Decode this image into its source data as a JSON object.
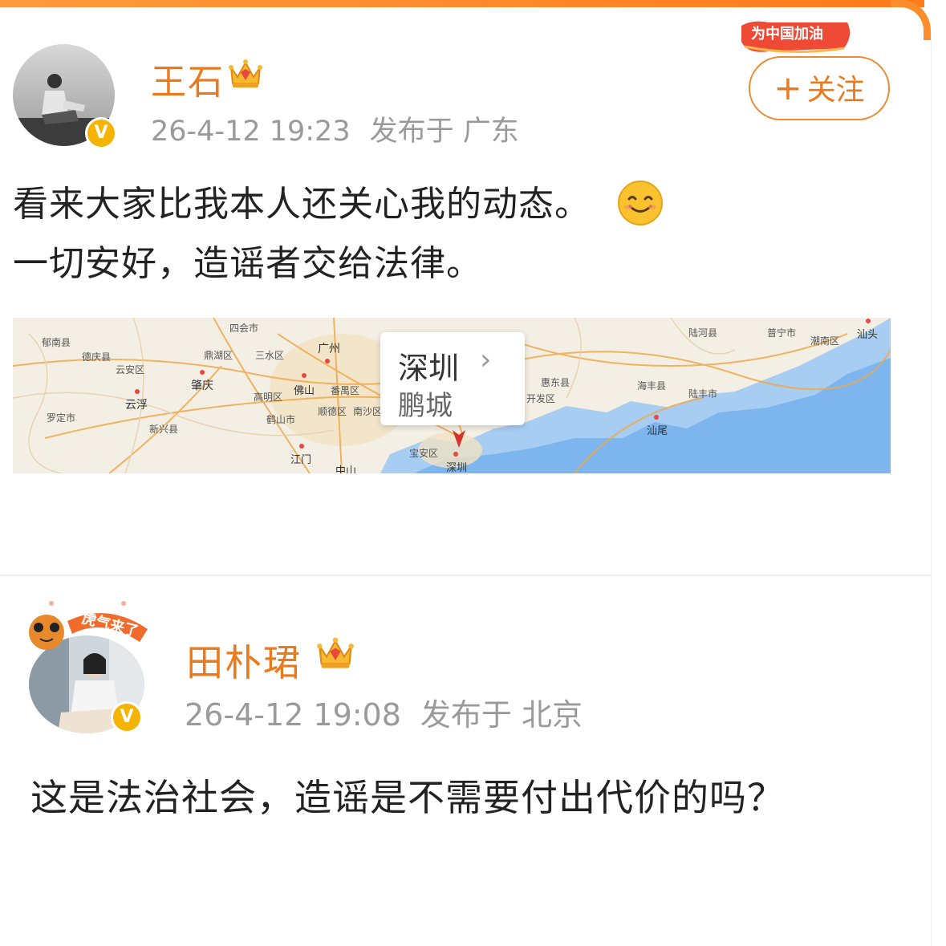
{
  "post1": {
    "username": "王石",
    "timestamp": "26-4-12 19:23",
    "location": "发布于 广东",
    "follow_badge": "为中国加油",
    "follow_label": "关注",
    "follow_plus": "+",
    "content_line1": "看来大家比我本人还关心我的动态。",
    "content_line2": "一切安好，造谣者交给法律。",
    "emoji": "smile-emoji",
    "map": {
      "city": "深圳",
      "district": "鹏城",
      "labels": [
        "四会市",
        "广州",
        "郁南县",
        "德庆县",
        "云安区",
        "鼎湖区",
        "三水区",
        "肇庆",
        "云浮",
        "佛山",
        "番禺区",
        "高明区",
        "罗定市",
        "新兴县",
        "鹤山市",
        "顺德区",
        "南沙区",
        "江门",
        "中山",
        "宝安区",
        "深圳",
        "惠东县",
        "开发区",
        "海丰县",
        "陆丰市",
        "陆河县",
        "普宁市",
        "潮南区",
        "汕头",
        "汕尾"
      ]
    }
  },
  "post2": {
    "username": "田朴珺",
    "timestamp": "26-4-12 19:08",
    "location": "发布于 北京",
    "avatar_frame_text": "虎气来了",
    "content_line1": "这是法治社会，造谣是不需要付出代价的吗？"
  },
  "icons": {
    "verified": "verified-v-icon",
    "crown": "vip-crown-icon",
    "chevron": "chevron-right-icon"
  },
  "colors": {
    "accent": "#ea7a1e",
    "verified": "#f5b400",
    "meta": "#9a9a9a"
  }
}
